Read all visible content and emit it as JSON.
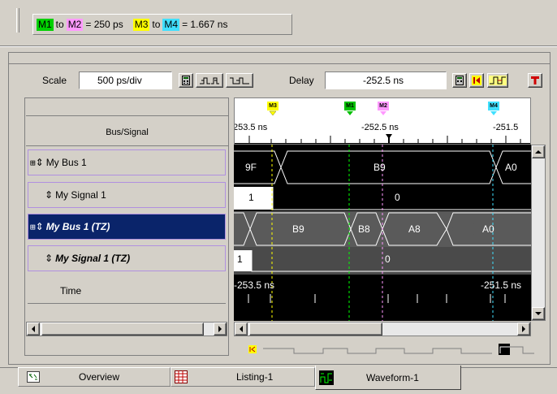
{
  "delta_bar": {
    "m1": "M1",
    "to1": "to",
    "m2": "M2",
    "eq1": "= 250 ps",
    "m3": "M3",
    "to2": "to",
    "m4": "M4",
    "eq2": "= 1.667 ns"
  },
  "controls": {
    "scale_label": "Scale",
    "scale_value": "500 ps/div",
    "delay_label": "Delay",
    "delay_value": "-252.5 ns"
  },
  "header": {
    "bus_signal": "Bus/Signal"
  },
  "markers": [
    {
      "label": "M3",
      "color": "#ffff00"
    },
    {
      "label": "M1",
      "color": "#00c000"
    },
    {
      "label": "M2",
      "color": "#ff80ff"
    },
    {
      "label": "M4",
      "color": "#40e0ff"
    }
  ],
  "ruler": {
    "left": "253.5 ns",
    "mid": "-252.5 ns",
    "right": "-251.5"
  },
  "signals": [
    {
      "name": "My Bus 1"
    },
    {
      "name": "My Signal 1"
    },
    {
      "name": "My Bus 1 (TZ)"
    },
    {
      "name": "My Signal 1 (TZ)"
    },
    {
      "name": "Time"
    }
  ],
  "wave": {
    "bus1": [
      "9F",
      "B9",
      "A0"
    ],
    "sig1": [
      "1",
      "0"
    ],
    "bus1tz": [
      "B9",
      "B8",
      "A8",
      "A0"
    ],
    "sig1tz": [
      "1",
      "0"
    ],
    "time_left": "-253.5 ns",
    "time_right": "-251.5 ns"
  },
  "tabs": [
    {
      "label": "Overview"
    },
    {
      "label": "Listing-1"
    },
    {
      "label": "Waveform-1"
    }
  ]
}
